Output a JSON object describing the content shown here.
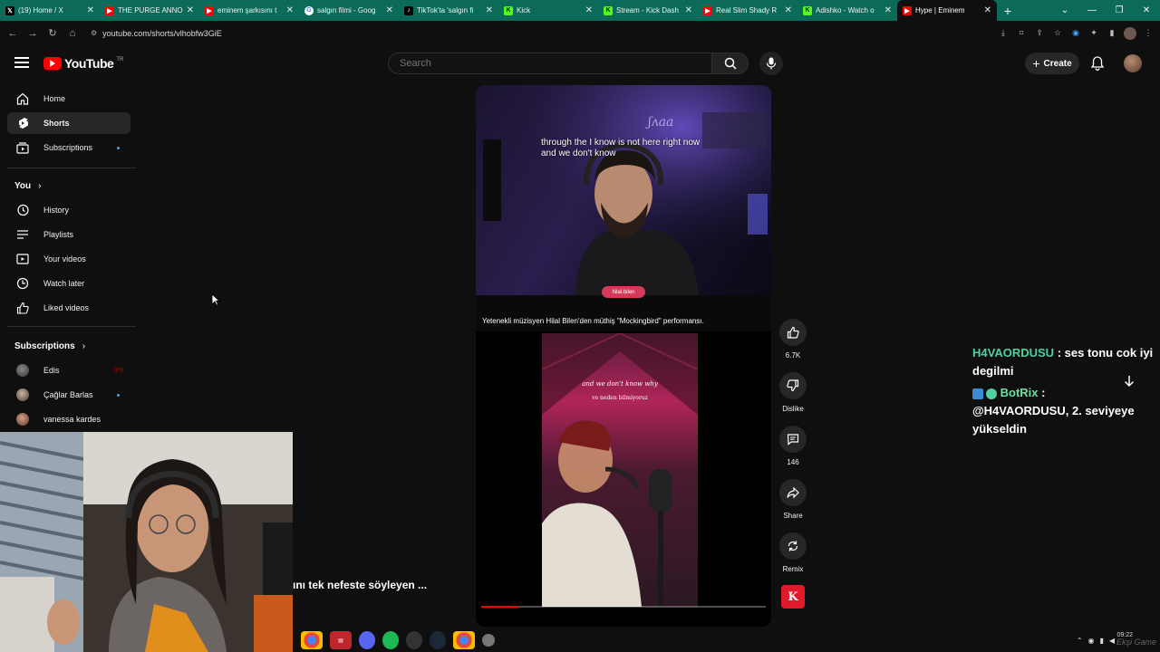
{
  "browser": {
    "tabs": [
      {
        "label": "(19) Home / X",
        "icon": "x-logo-icon",
        "color": "#000000"
      },
      {
        "label": "THE PURGE ANNO",
        "icon": "youtube-icon",
        "color": "#ff0000"
      },
      {
        "label": "eminem şarkısını t",
        "icon": "youtube-icon",
        "color": "#ff0000"
      },
      {
        "label": "salgın filmi - Goog",
        "icon": "google-icon",
        "color": "#ffffff"
      },
      {
        "label": "TikTok'ta 'salgın fi",
        "icon": "tiktok-icon",
        "color": "#000000"
      },
      {
        "label": "Kick",
        "icon": "kick-icon",
        "color": "#53fc18"
      },
      {
        "label": "Stream - Kick Dash",
        "icon": "kick-icon",
        "color": "#53fc18"
      },
      {
        "label": "Real Slim Shady R",
        "icon": "youtube-icon",
        "color": "#ff0000"
      },
      {
        "label": "Adishko - Watch o",
        "icon": "kick-icon",
        "color": "#53fc18"
      },
      {
        "label": "Hype | Eminem",
        "icon": "youtube-icon",
        "color": "#ff0000"
      }
    ],
    "url": "youtube.com/shorts/vlhobfw3GiE"
  },
  "header": {
    "logo_text": "YouTube",
    "country_code": "TR",
    "search_placeholder": "Search",
    "create_label": "Create"
  },
  "sidebar": {
    "items": [
      {
        "label": "Home",
        "icon": "home-icon"
      },
      {
        "label": "Shorts",
        "icon": "shorts-icon"
      },
      {
        "label": "Subscriptions",
        "icon": "subscriptions-icon"
      }
    ],
    "you_heading": "You",
    "you_items": [
      {
        "label": "History",
        "icon": "history-icon"
      },
      {
        "label": "Playlists",
        "icon": "playlists-icon"
      },
      {
        "label": "Your videos",
        "icon": "your-videos-icon"
      },
      {
        "label": "Watch later",
        "icon": "watch-later-icon"
      },
      {
        "label": "Liked videos",
        "icon": "liked-videos-icon"
      }
    ],
    "subscriptions_heading": "Subscriptions",
    "subscriptions": [
      {
        "label": "Edis",
        "status": "live"
      },
      {
        "label": "Çağlar Barlas",
        "status": "new"
      },
      {
        "label": "vanessa kardes",
        "status": ""
      }
    ]
  },
  "short": {
    "subtitle_line1": "through the I know is not here right now",
    "subtitle_line2": "and we don't know",
    "tag": "hilal.bilen",
    "caption": "Yetenekli müzisyen Hilal Bilen'den müthiş \"Mockingbird\" performansı.",
    "lyric_en": "and we don't know why",
    "lyric_tr": "ve neden bilmiyoruz",
    "progress": 0.13
  },
  "actions": {
    "like_count": "6.7K",
    "dislike_label": "Dislike",
    "comment_count": "146",
    "share_label": "Share",
    "remix_label": "Remix",
    "channel_badge": "K"
  },
  "overlay": {
    "title_fragment": "ını tek nefeste söyleyen ..."
  },
  "chat": {
    "msg1_user": "H4VAORDUSU",
    "msg1_text": "ses tonu cok iyi degilmi",
    "msg2_user": "BotRix",
    "msg2_text": "@H4VAORDUSU, 2. seviyeye yükseldin"
  },
  "taskbar": {
    "time": "09:22",
    "watermark": "Ekşi Game"
  },
  "colors": {
    "accent": "#ff0000",
    "tabstrip": "#0b6b58",
    "chat_user": "#4fd1a0"
  }
}
